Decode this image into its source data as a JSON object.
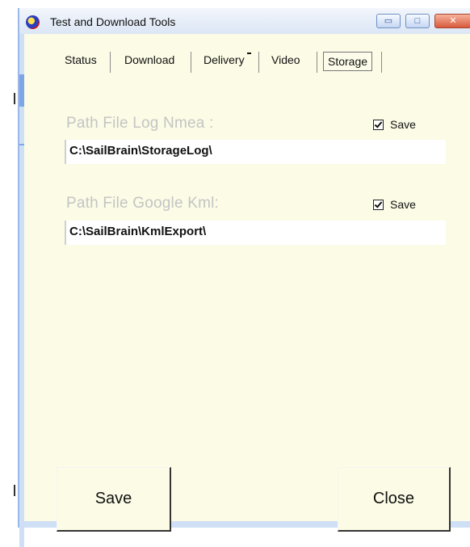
{
  "window": {
    "title": "Test and Download Tools",
    "controls": {
      "minimize": "▭",
      "maximize": "□",
      "close": "✕"
    }
  },
  "tabs": [
    {
      "label": "Status"
    },
    {
      "label": "Download"
    },
    {
      "label": "Delivery"
    },
    {
      "label": "Video"
    },
    {
      "label": "Storage",
      "active": true
    }
  ],
  "storage": {
    "nmea": {
      "label": "Path File Log Nmea :",
      "save_label": "Save",
      "save_checked": true,
      "path": "C:\\SailBrain\\StorageLog\\"
    },
    "kml": {
      "label": "Path File Google Kml:",
      "save_label": "Save",
      "save_checked": true,
      "path": "C:\\SailBrain\\KmlExport\\"
    }
  },
  "buttons": {
    "save": "Save",
    "close": "Close"
  },
  "colors": {
    "label_gray": "#c4c4c4",
    "client_bg": "#fcfbe6",
    "frame_blue": "#cfe0f6"
  }
}
